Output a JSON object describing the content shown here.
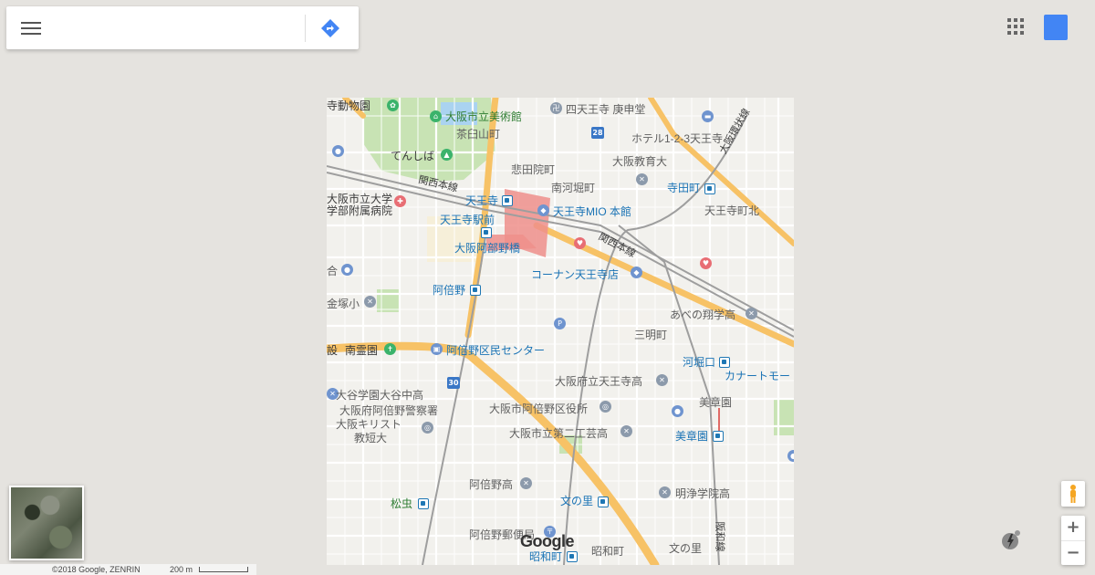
{
  "search": {
    "placeholder": "",
    "value": ""
  },
  "icons": {
    "menu": "hamburger-menu-icon",
    "directions": "directions-icon",
    "apps": "apps-grid-icon",
    "pegman": "pegman-icon",
    "layers": "layers-icon"
  },
  "colors": {
    "accent": "#4285f4",
    "map_background": "#e5e3df",
    "highway": "#f7c266",
    "park": "#c8e3b4",
    "station_area": "#ef8f8b",
    "water": "#aad3f0"
  },
  "map": {
    "labels": {
      "tennoji_zoo": "寺動物園",
      "osaka_art_museum": "大阪市立美術館",
      "chausuyama": "茶臼山町",
      "tenshiba": "てんしば",
      "shitennoji_koshindo": "四天王寺 庚申堂",
      "hotel_123": "ホテル1-2-3天王寺",
      "osaka_kyoiku_univ": "大阪教育大",
      "hidenin": "悲田院町",
      "minami_kawahori": "南河堀町",
      "teradacho": "寺田町",
      "tennoji_kitasu": "天王寺町北",
      "kansai_line_1": "関西本線",
      "kansai_line_2": "関西本線",
      "osaka_kanjo_line": "大阪環状線",
      "tennoji": "天王寺",
      "tennoji_mio": "天王寺MIO 本館",
      "tennoji_ekimae": "天王寺駅前",
      "abeno_harukas": "大阪阿部野橋",
      "city_hospital_1": "大阪市立大学",
      "city_hospital_2": "学部附属病院",
      "konan": "コーナン天王寺店",
      "ai": "合",
      "kanazuka": "金塚小",
      "abeno": "阿倍野",
      "abeno_shoho": "あべの翔学高",
      "sannomiya": "三明町",
      "shisetsu": "設",
      "nanrei": "南霊園",
      "abeno_civic": "阿倍野区民センター",
      "kawahori_guchi": "河堀口",
      "kanart": "カナートモー",
      "tennoji_hs": "大阪府立天王寺高",
      "otani": "大谷学園大谷中高",
      "abeno_ward_office": "大阪市阿倍野区役所",
      "bishoen": "美章園",
      "abeno_police": "大阪府阿倍野警察署",
      "christ": "大阪キリスト",
      "kyoiku_junior": "教短大",
      "daini_kogei": "大阪市立第二工芸高",
      "bishoen_station": "美章園",
      "abeno_hs": "阿倍野高",
      "fuminosato": "文の里",
      "matsumushi": "松虫",
      "meijo": "明浄学院高",
      "hanwa_line": "阪和線",
      "abeno_post": "阿倍野郵便局",
      "showacho": "昭和町",
      "showacho_2": "昭和町",
      "fuminosato_2": "文の里",
      "route_28": "28",
      "route_30": "30"
    },
    "google_logo": "Google"
  },
  "footer": {
    "copyright": "©2018 Google, ZENRIN",
    "scale": "200 m"
  },
  "zoom": {
    "in": "+",
    "out": "−"
  }
}
